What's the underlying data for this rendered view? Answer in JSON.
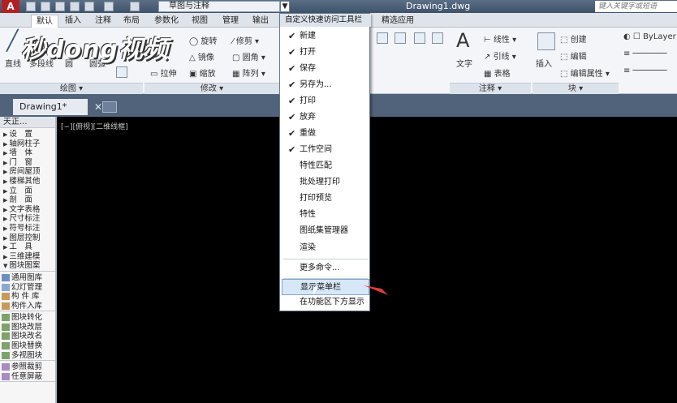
{
  "qat": {
    "logo": "A",
    "workspace": "草图与注释",
    "dropdown_arrow": "▼",
    "title": "Drawing1.dwg",
    "search_placeholder": "键入关键字或短语"
  },
  "ribbon_tabs": [
    "默认",
    "插入",
    "注释",
    "布局",
    "参数化",
    "视图",
    "管理",
    "输出",
    "精选应用"
  ],
  "ribbon": {
    "draw_tools": [
      "直线",
      "多段线",
      "圆",
      "圆弧"
    ],
    "modify_tools": [
      "旋转",
      "修剪",
      "镜像",
      "圆角",
      "拉伸",
      "缩放",
      "阵列"
    ],
    "annotation_tools": [
      "文字",
      "线性",
      "引线",
      "表格"
    ],
    "block_tools": [
      "插入",
      "创建",
      "编辑",
      "编辑属性"
    ],
    "layer_value": "ByLayer",
    "panels": [
      "绘图 ▾",
      "修改 ▾",
      "注释 ▾",
      "块 ▾"
    ]
  },
  "doc_tab": {
    "label": "Drawing1*",
    "close": "✕"
  },
  "viewport_label": "[−][俯视][二维线框]",
  "side_panel": {
    "header": "天正...",
    "group1": [
      "设　置",
      "轴网柱子",
      "墙　体",
      "门　窗",
      "房间屋顶",
      "楼梯其他",
      "立　面",
      "剖　面",
      "文字表格",
      "尺寸标注",
      "符号标注",
      "图层控制",
      "工　具",
      "三维建模",
      "图块图案"
    ],
    "group2": [
      "通用图库",
      "幻灯管理",
      "构 件 库",
      "构件入库"
    ],
    "group3": [
      "图块转化",
      "图块改层",
      "图块改名",
      "图块替换",
      "多视图块"
    ],
    "group4": [
      "参照裁剪",
      "任意屏蔽"
    ]
  },
  "menu": {
    "title": "自定义快速访问工具栏",
    "checked_items": [
      "新建",
      "打开",
      "保存",
      "另存为...",
      "打印",
      "放弃",
      "重做",
      "工作空间"
    ],
    "unchecked_items": [
      "特性匹配",
      "批处理打印",
      "打印预览",
      "特性",
      "图纸集管理器",
      "渲染"
    ],
    "more": "更多命令...",
    "show_menubar": "显示菜单栏",
    "show_below": "在功能区下方显示"
  },
  "watermark": "秒dong视频",
  "colors": {
    "accent": "#d8e7f7",
    "logo_red": "#b32024",
    "arrow_red": "#e23a3a"
  }
}
